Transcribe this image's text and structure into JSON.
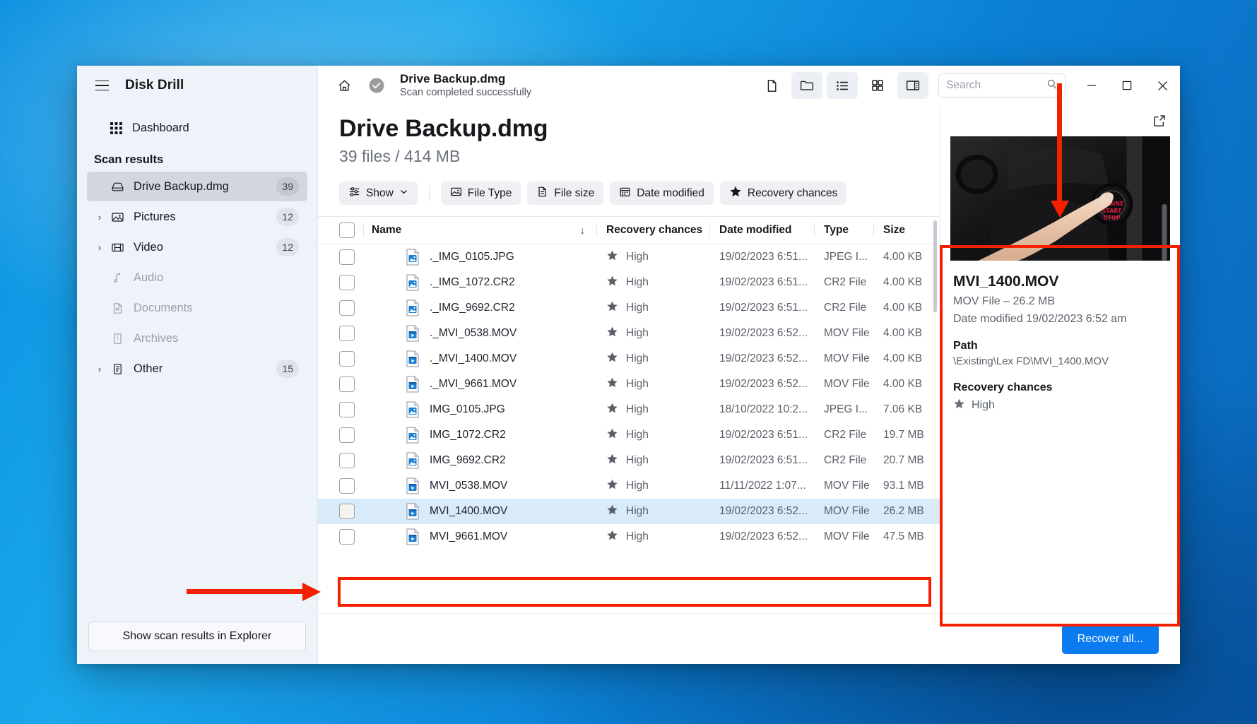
{
  "app": {
    "title": "Disk Drill",
    "menu_icon": "hamburger-icon"
  },
  "sidebar": {
    "dashboard": {
      "label": "Dashboard",
      "icon": "grid-icon"
    },
    "section_label": "Scan results",
    "items": [
      {
        "label": "Drive Backup.dmg",
        "count": "39",
        "icon": "disk-icon",
        "state": "active",
        "expandable": false
      },
      {
        "label": "Pictures",
        "count": "12",
        "icon": "image-icon",
        "state": "normal",
        "expandable": true
      },
      {
        "label": "Video",
        "count": "12",
        "icon": "video-icon",
        "state": "normal",
        "expandable": true
      },
      {
        "label": "Audio",
        "count": "",
        "icon": "audio-icon",
        "state": "disabled",
        "expandable": false
      },
      {
        "label": "Documents",
        "count": "",
        "icon": "document-icon",
        "state": "disabled",
        "expandable": false
      },
      {
        "label": "Archives",
        "count": "",
        "icon": "archive-icon",
        "state": "disabled",
        "expandable": false
      },
      {
        "label": "Other",
        "count": "15",
        "icon": "other-icon",
        "state": "normal",
        "expandable": true
      }
    ],
    "bottom_button": "Show scan results in Explorer"
  },
  "titlebar": {
    "home_icon": "home-icon",
    "status_icon": "check-circle-icon",
    "title": "Drive Backup.dmg",
    "subtitle": "Scan completed successfully",
    "tools": [
      {
        "name": "file-view-button",
        "icon": "file-icon",
        "active": false
      },
      {
        "name": "folder-view-button",
        "icon": "folder-icon",
        "active": true
      },
      {
        "name": "list-view-button",
        "icon": "list-icon",
        "active": true
      },
      {
        "name": "grid-view-button",
        "icon": "grid-view-icon",
        "active": false
      },
      {
        "name": "preview-pane-button",
        "icon": "panel-icon",
        "active": true
      }
    ],
    "search": {
      "placeholder": "Search",
      "value": "",
      "icon": "search-icon"
    },
    "window_controls": {
      "minimize": "minimize-icon",
      "maximize": "maximize-icon",
      "close": "close-icon"
    }
  },
  "page": {
    "title": "Drive Backup.dmg",
    "subtitle": "39 files / 414 MB"
  },
  "filters": {
    "show": {
      "label": "Show",
      "icon": "sliders-icon",
      "chevron": "chevron-down-icon"
    },
    "chips": [
      {
        "label": "File Type",
        "icon": "image-icon"
      },
      {
        "label": "File size",
        "icon": "document-icon"
      },
      {
        "label": "Date modified",
        "icon": "calendar-icon"
      },
      {
        "label": "Recovery chances",
        "icon": "star-icon"
      }
    ]
  },
  "table": {
    "columns": [
      "Name",
      "Recovery chances",
      "Date modified",
      "Type",
      "Size"
    ],
    "sort_column": "Name",
    "sort_direction": "descending",
    "sort_icon": "arrow-down-icon",
    "rows": [
      {
        "name": "._IMG_0105.JPG",
        "icon": "image-file-icon",
        "recovery": "High",
        "date": "19/02/2023 6:51...",
        "type": "JPEG I...",
        "size": "4.00 KB",
        "selected": false
      },
      {
        "name": "._IMG_1072.CR2",
        "icon": "image-file-icon",
        "recovery": "High",
        "date": "19/02/2023 6:51...",
        "type": "CR2 File",
        "size": "4.00 KB",
        "selected": false
      },
      {
        "name": "._IMG_9692.CR2",
        "icon": "image-file-icon",
        "recovery": "High",
        "date": "19/02/2023 6:51...",
        "type": "CR2 File",
        "size": "4.00 KB",
        "selected": false
      },
      {
        "name": "._MVI_0538.MOV",
        "icon": "video-file-icon",
        "recovery": "High",
        "date": "19/02/2023 6:52...",
        "type": "MOV File",
        "size": "4.00 KB",
        "selected": false
      },
      {
        "name": "._MVI_1400.MOV",
        "icon": "video-file-icon",
        "recovery": "High",
        "date": "19/02/2023 6:52...",
        "type": "MOV File",
        "size": "4.00 KB",
        "selected": false
      },
      {
        "name": "._MVI_9661.MOV",
        "icon": "video-file-icon",
        "recovery": "High",
        "date": "19/02/2023 6:52...",
        "type": "MOV File",
        "size": "4.00 KB",
        "selected": false
      },
      {
        "name": "IMG_0105.JPG",
        "icon": "image-file-icon",
        "recovery": "High",
        "date": "18/10/2022 10:2...",
        "type": "JPEG I...",
        "size": "7.06 KB",
        "selected": false
      },
      {
        "name": "IMG_1072.CR2",
        "icon": "image-file-icon",
        "recovery": "High",
        "date": "19/02/2023 6:51...",
        "type": "CR2 File",
        "size": "19.7 MB",
        "selected": false
      },
      {
        "name": "IMG_9692.CR2",
        "icon": "image-file-icon",
        "recovery": "High",
        "date": "19/02/2023 6:51...",
        "type": "CR2 File",
        "size": "20.7 MB",
        "selected": false
      },
      {
        "name": "MVI_0538.MOV",
        "icon": "video-file-icon",
        "recovery": "High",
        "date": "11/11/2022 1:07...",
        "type": "MOV File",
        "size": "93.1 MB",
        "selected": false
      },
      {
        "name": "MVI_1400.MOV",
        "icon": "video-file-icon",
        "recovery": "High",
        "date": "19/02/2023 6:52...",
        "type": "MOV File",
        "size": "26.2 MB",
        "selected": true
      },
      {
        "name": "MVI_9661.MOV",
        "icon": "video-file-icon",
        "recovery": "High",
        "date": "19/02/2023 6:52...",
        "type": "MOV File",
        "size": "47.5 MB",
        "selected": false
      }
    ]
  },
  "preview": {
    "expand_icon": "external-link-icon",
    "thumbnail_alt": "finger pressing car engine start stop button",
    "name": "MVI_1400.MOV",
    "meta": "MOV File – 26.2 MB",
    "date_modified": "Date modified 19/02/2023 6:52 am",
    "path_heading": "Path",
    "path_value": "\\Existing\\Lex FD\\MVI_1400.MOV",
    "recovery_heading": "Recovery chances",
    "recovery_value": "High",
    "recovery_icon": "star-icon"
  },
  "footer": {
    "recover_button": "Recover all..."
  },
  "annotations": {
    "color": "#f42000",
    "arrow_to_row": "arrow pointing right at MVI_1400.MOV row",
    "arrow_to_preview": "arrow pointing down at preview panel",
    "box_row": "red rectangle around MVI_1400.MOV row",
    "box_preview": "red rectangle around preview panel"
  }
}
